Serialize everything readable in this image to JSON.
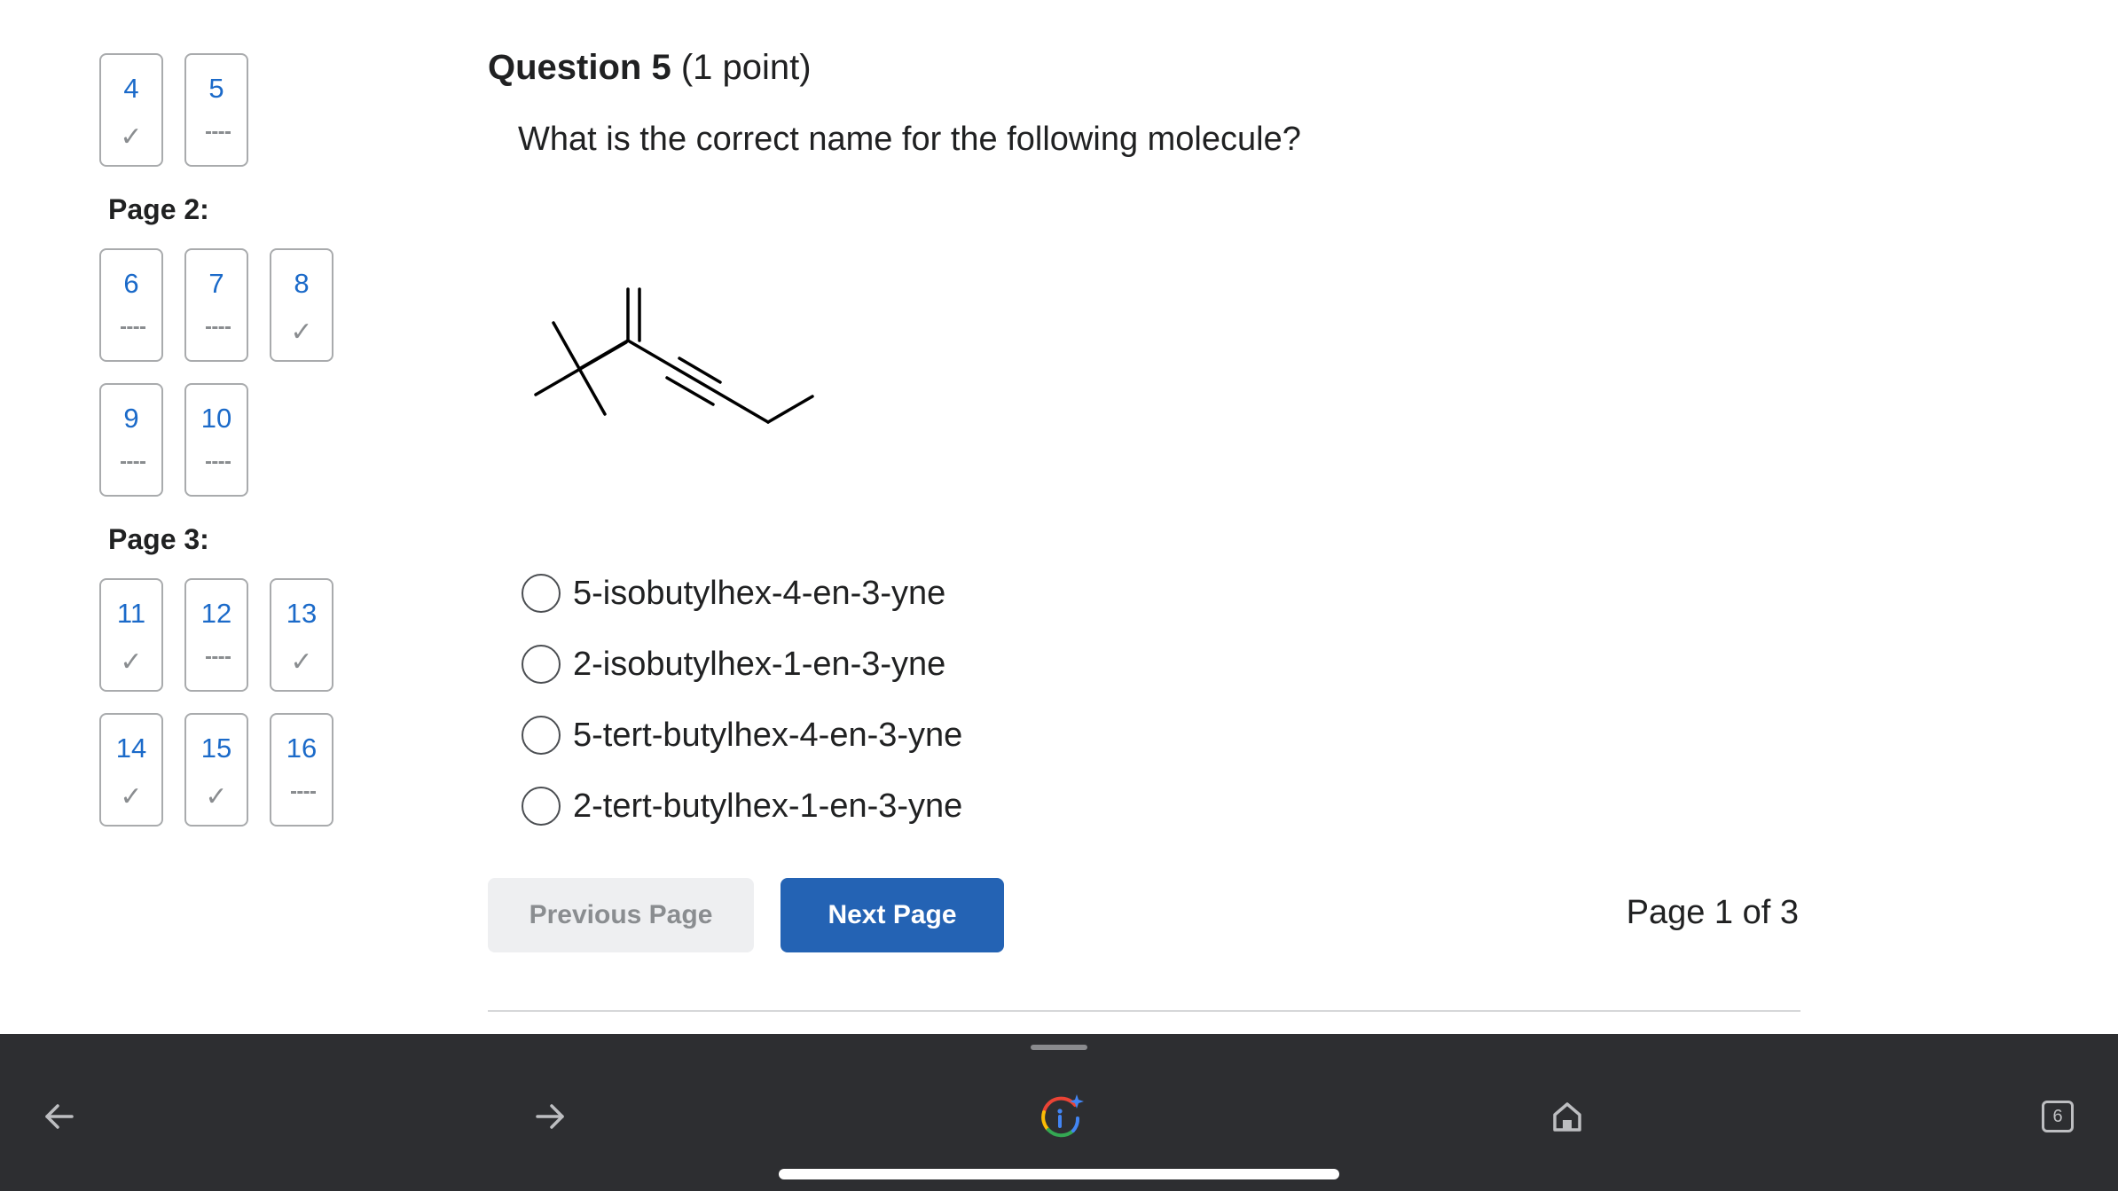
{
  "sidebar": {
    "boxes_top": [
      {
        "num": "4",
        "status": "check"
      },
      {
        "num": "5",
        "status": "dash"
      }
    ],
    "page2_label": "Page 2:",
    "boxes_page2": [
      {
        "num": "6",
        "status": "dash"
      },
      {
        "num": "7",
        "status": "dash"
      },
      {
        "num": "8",
        "status": "check"
      },
      {
        "num": "9",
        "status": "dash"
      },
      {
        "num": "10",
        "status": "dash"
      }
    ],
    "page3_label": "Page 3:",
    "boxes_page3": [
      {
        "num": "11",
        "status": "check"
      },
      {
        "num": "12",
        "status": "dash"
      },
      {
        "num": "13",
        "status": "check"
      },
      {
        "num": "14",
        "status": "check"
      },
      {
        "num": "15",
        "status": "check"
      },
      {
        "num": "16",
        "status": "dash"
      }
    ],
    "check_glyph": "✓"
  },
  "question": {
    "title": "Question 5",
    "points": "(1 point)",
    "text": "What is the correct name for the following molecule?",
    "options": [
      "5-isobutylhex-4-en-3-yne",
      "2-isobutylhex-1-en-3-yne",
      "5-tert-butylhex-4-en-3-yne",
      "2-tert-butylhex-1-en-3-yne"
    ]
  },
  "nav": {
    "prev_label": "Previous Page",
    "next_label": "Next Page",
    "page_indicator": "Page 1 of 3"
  },
  "browser_toolbar": {
    "back_icon": "back-arrow-icon",
    "forward_icon": "forward-arrow-icon",
    "assistant_icon": "google-info-icon",
    "home_icon": "home-icon",
    "tabs_count": "6"
  },
  "colors": {
    "link_blue": "#1b6ac9",
    "button_blue": "#2463b4",
    "toolbar_bg": "#2d2e31"
  }
}
